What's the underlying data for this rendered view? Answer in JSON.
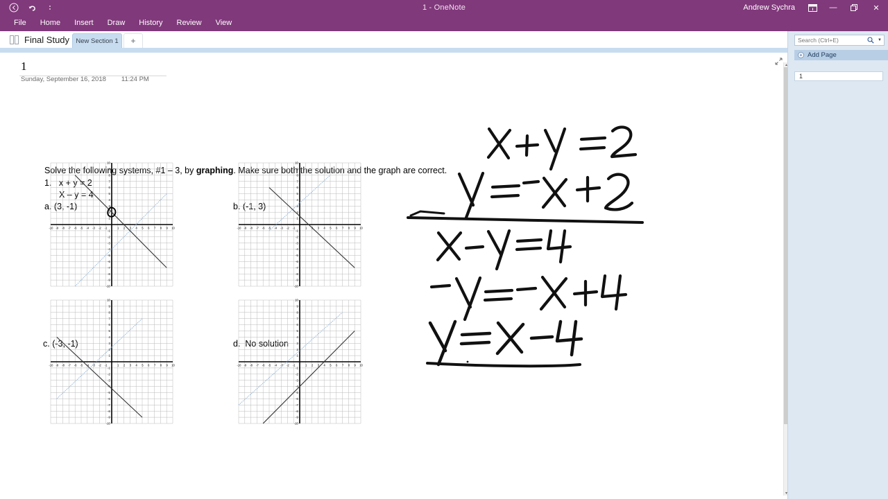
{
  "window": {
    "title": "1  -  OneNote",
    "user": "Andrew Sychra",
    "back_icon": "back-arrow-icon",
    "undo_icon": "undo-icon",
    "more_icon": "more-options-icon",
    "ribbon_display_icon": "ribbon-display-options-icon",
    "minimize_label": "—",
    "restore_label": "❐",
    "close_label": "✕",
    "accent_color": "#80397b"
  },
  "ribbon": {
    "tabs": [
      "File",
      "Home",
      "Insert",
      "Draw",
      "History",
      "Review",
      "View"
    ]
  },
  "sectionbar": {
    "notebook_name": "Final Study",
    "notebook_icon": "notebook-icon",
    "caret_icon": "chevron-down-icon",
    "tabs": [
      {
        "label": "New Section 1",
        "active": true
      },
      {
        "label": "+",
        "active": false
      }
    ],
    "accent_color": "#c8dcf0"
  },
  "page": {
    "title": "1",
    "date": "Sunday, September 16, 2018",
    "time": "11:24 PM",
    "expand_icon": "expand-page-icon"
  },
  "content": {
    "prompt_before_bold": "Solve the following systems, #1 – 3, by ",
    "prompt_bold": "graphing",
    "prompt_after_bold": ".  Make sure both the solution and the graph are correct.",
    "problem_number": "1.",
    "equation_1": "x + y = 2",
    "equation_2": "X – y = 4",
    "options": [
      {
        "key": "a.",
        "text": "(3, -1)"
      },
      {
        "key": "b.",
        "text": "(-1, 3)"
      },
      {
        "key": "c.",
        "text": "(-3, -1)"
      },
      {
        "key": "d.",
        "text": "No solution"
      }
    ],
    "ink_notes": {
      "line_1": "x + y = 2",
      "line_2": "y = ⁻x + 2",
      "line_3": "x – y = 4",
      "line_4": "−y = −x + 4",
      "line_5": "y = x – 4",
      "circle_annotation": "circled-point-on-graph-a",
      "ink_color": "#111111"
    }
  },
  "chart_data": [
    {
      "id": "graph-a",
      "type": "line",
      "title": "a. (3, -1)",
      "xlabel": "x",
      "ylabel": "y",
      "xlim": [
        -10,
        10
      ],
      "ylim": [
        -10,
        10
      ],
      "grid": true,
      "xticks": [
        -10,
        -9,
        -8,
        -7,
        -6,
        -5,
        -4,
        -3,
        -2,
        -1,
        1,
        2,
        3,
        4,
        5,
        6,
        7,
        8,
        9,
        10
      ],
      "yticks": [
        -10,
        -9,
        -8,
        -7,
        -6,
        -5,
        -4,
        -3,
        -2,
        -1,
        1,
        2,
        3,
        4,
        5,
        6,
        7,
        8,
        9,
        10
      ],
      "series": [
        {
          "name": "y = -x + 2",
          "color": "#333333",
          "style": "solid",
          "points": [
            [
              -6,
              8
            ],
            [
              9,
              -7
            ]
          ]
        },
        {
          "name": "y = x - 4",
          "color": "#8fb4d9",
          "style": "dashed",
          "points": [
            [
              -6,
              -10
            ],
            [
              9,
              5
            ]
          ]
        }
      ],
      "annotation": {
        "type": "ink-circle",
        "at": [
          0,
          2
        ]
      }
    },
    {
      "id": "graph-b",
      "type": "line",
      "title": "b. (-1, 3)",
      "xlabel": "x",
      "ylabel": "y",
      "xlim": [
        -10,
        10
      ],
      "ylim": [
        -10,
        10
      ],
      "grid": true,
      "series": [
        {
          "name": "descending",
          "color": "#333333",
          "style": "solid",
          "points": [
            [
              -5,
              6
            ],
            [
              9,
              -7
            ]
          ]
        },
        {
          "name": "ascending",
          "color": "#8fb4d9",
          "style": "dashed",
          "points": [
            [
              -5,
              -1
            ],
            [
              5,
              8
            ]
          ]
        }
      ]
    },
    {
      "id": "graph-c",
      "type": "line",
      "title": "c. (-3, -1)",
      "xlabel": "x",
      "ylabel": "y",
      "xlim": [
        -10,
        10
      ],
      "ylim": [
        -10,
        10
      ],
      "grid": true,
      "series": [
        {
          "name": "descending",
          "color": "#333333",
          "style": "solid",
          "points": [
            [
              -9,
              4
            ],
            [
              5,
              -9
            ]
          ]
        },
        {
          "name": "ascending",
          "color": "#8fb4d9",
          "style": "dashed",
          "points": [
            [
              -9,
              -6
            ],
            [
              5,
              7
            ]
          ]
        }
      ]
    },
    {
      "id": "graph-d",
      "type": "line",
      "title": "d. No solution",
      "xlabel": "x",
      "ylabel": "y",
      "xlim": [
        -10,
        10
      ],
      "ylim": [
        -10,
        10
      ],
      "grid": true,
      "series": [
        {
          "name": "upper parallel",
          "color": "#8fb4d9",
          "style": "dashed",
          "points": [
            [
              -10,
              -7
            ],
            [
              7,
              8
            ]
          ]
        },
        {
          "name": "lower parallel",
          "color": "#333333",
          "style": "solid",
          "points": [
            [
              -6,
              -10
            ],
            [
              9,
              5
            ]
          ]
        }
      ]
    }
  ],
  "pagepane": {
    "search_placeholder": "Search (Ctrl+E)",
    "search_value": "",
    "search_icon": "search-icon",
    "search_caret_icon": "chevron-down-icon",
    "add_page_label": "Add Page",
    "add_page_icon": "plus-circle-icon",
    "pages": [
      {
        "label": "1",
        "selected": true
      }
    ]
  },
  "scrollbar": {
    "up_icon": "scroll-up-icon",
    "down_icon": "scroll-down-icon"
  }
}
